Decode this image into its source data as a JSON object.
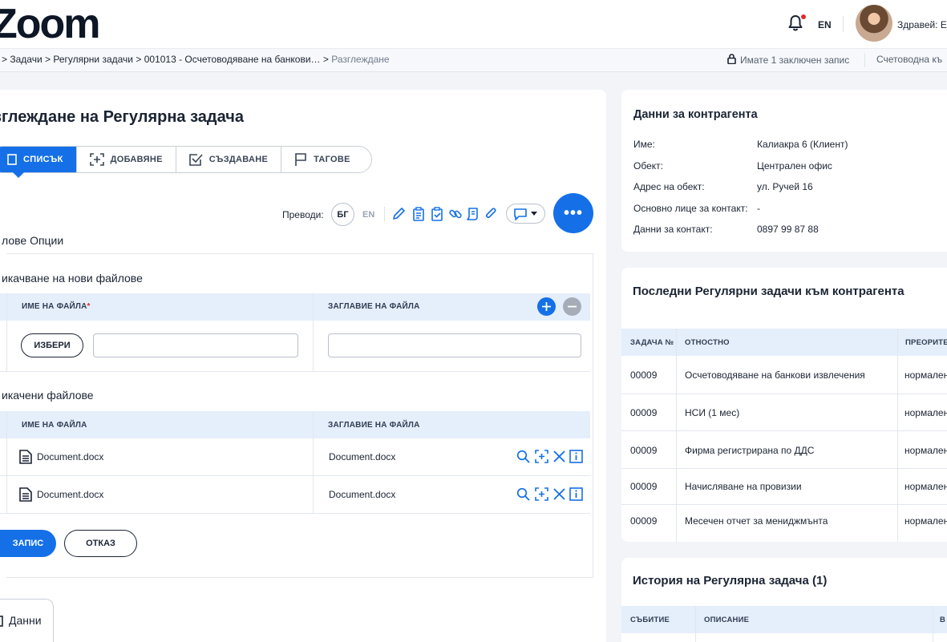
{
  "header": {
    "logo": "Zoom",
    "language": "EN",
    "greeting": "Здравей: Е"
  },
  "breadcrumb": {
    "items": [
      ">",
      "Задачи",
      ">",
      "Регулярни задачи",
      ">",
      "001013 - Осчетоводяване на банкови…",
      ">"
    ],
    "current": "Разглеждане",
    "locked_notice": "Имате 1 заключен запис",
    "account": "Счетоводна къ"
  },
  "main": {
    "title": "зглеждане на Регулярна задача",
    "tabs": [
      {
        "label": "СПИСЪК",
        "icon": "list-icon"
      },
      {
        "label": "ДОБАВЯНЕ",
        "icon": "add-icon"
      },
      {
        "label": "СЪЗДАВАНЕ",
        "icon": "checkbox-icon"
      },
      {
        "label": "ТАГОВЕ",
        "icon": "flag-icon"
      }
    ],
    "translations_label": "Преводи:",
    "lang_bg": "БГ",
    "lang_en": "EN",
    "more_label": "•••",
    "file_options_title": "лове Опции",
    "upload_title": "икачване на нови файлове",
    "col_file_name": "ИМЕ НА ФАЙЛА",
    "col_file_title": "ЗАГЛАВИЕ НА ФАЙЛА",
    "required_mark": "*",
    "choose_label": "ИЗБЕРИ",
    "uploaded_title": "икачени файлове",
    "files": [
      {
        "name": "Document.docx",
        "title": "Document.docx"
      },
      {
        "name": "Document.docx",
        "title": "Document.docx"
      }
    ],
    "save_label": "ЗАПИС",
    "cancel_label": "ОТКАЗ",
    "data_tab_label": "Данни"
  },
  "contractor": {
    "title": "Данни за контрагента",
    "fields": [
      {
        "key": "Име:",
        "value": "Калиакра 6 (Клиент)"
      },
      {
        "key": "Обект:",
        "value": "Централен офис"
      },
      {
        "key": "Адрес на обект:",
        "value": "ул. Ручей 16"
      },
      {
        "key": "Основно лице за контакт:",
        "value": "-"
      },
      {
        "key": "Данни за контакт:",
        "value": "0897 99 87 88"
      }
    ]
  },
  "recent": {
    "title": "Последни Регулярни задачи към контрагента",
    "columns": [
      "ЗАДАЧА №",
      "ОТНОСТНО",
      "ПРЕОРИТЕ"
    ],
    "rows": [
      {
        "id": "00009",
        "subject": "Осчетоводяване на банкови извлечения",
        "priority": "нормален"
      },
      {
        "id": "00009",
        "subject": "НСИ (1 мес)",
        "priority": "нормален"
      },
      {
        "id": "00009",
        "subject": "Фирма регистрирана по ДДС",
        "priority": "нормален"
      },
      {
        "id": "00009",
        "subject": "Начисляване на провизии",
        "priority": "нормален"
      },
      {
        "id": "00009",
        "subject": "Месечен отчет за мениджмънта",
        "priority": "нормален"
      }
    ]
  },
  "history": {
    "title": "История на Регулярна задача (1)",
    "columns": [
      "СЪБИТИЕ",
      "ОПИСАНИЕ",
      "В"
    ]
  },
  "colors": {
    "accent": "#1570e8",
    "header_row": "#e5eefb",
    "page_bg": "#f2f4f8"
  }
}
